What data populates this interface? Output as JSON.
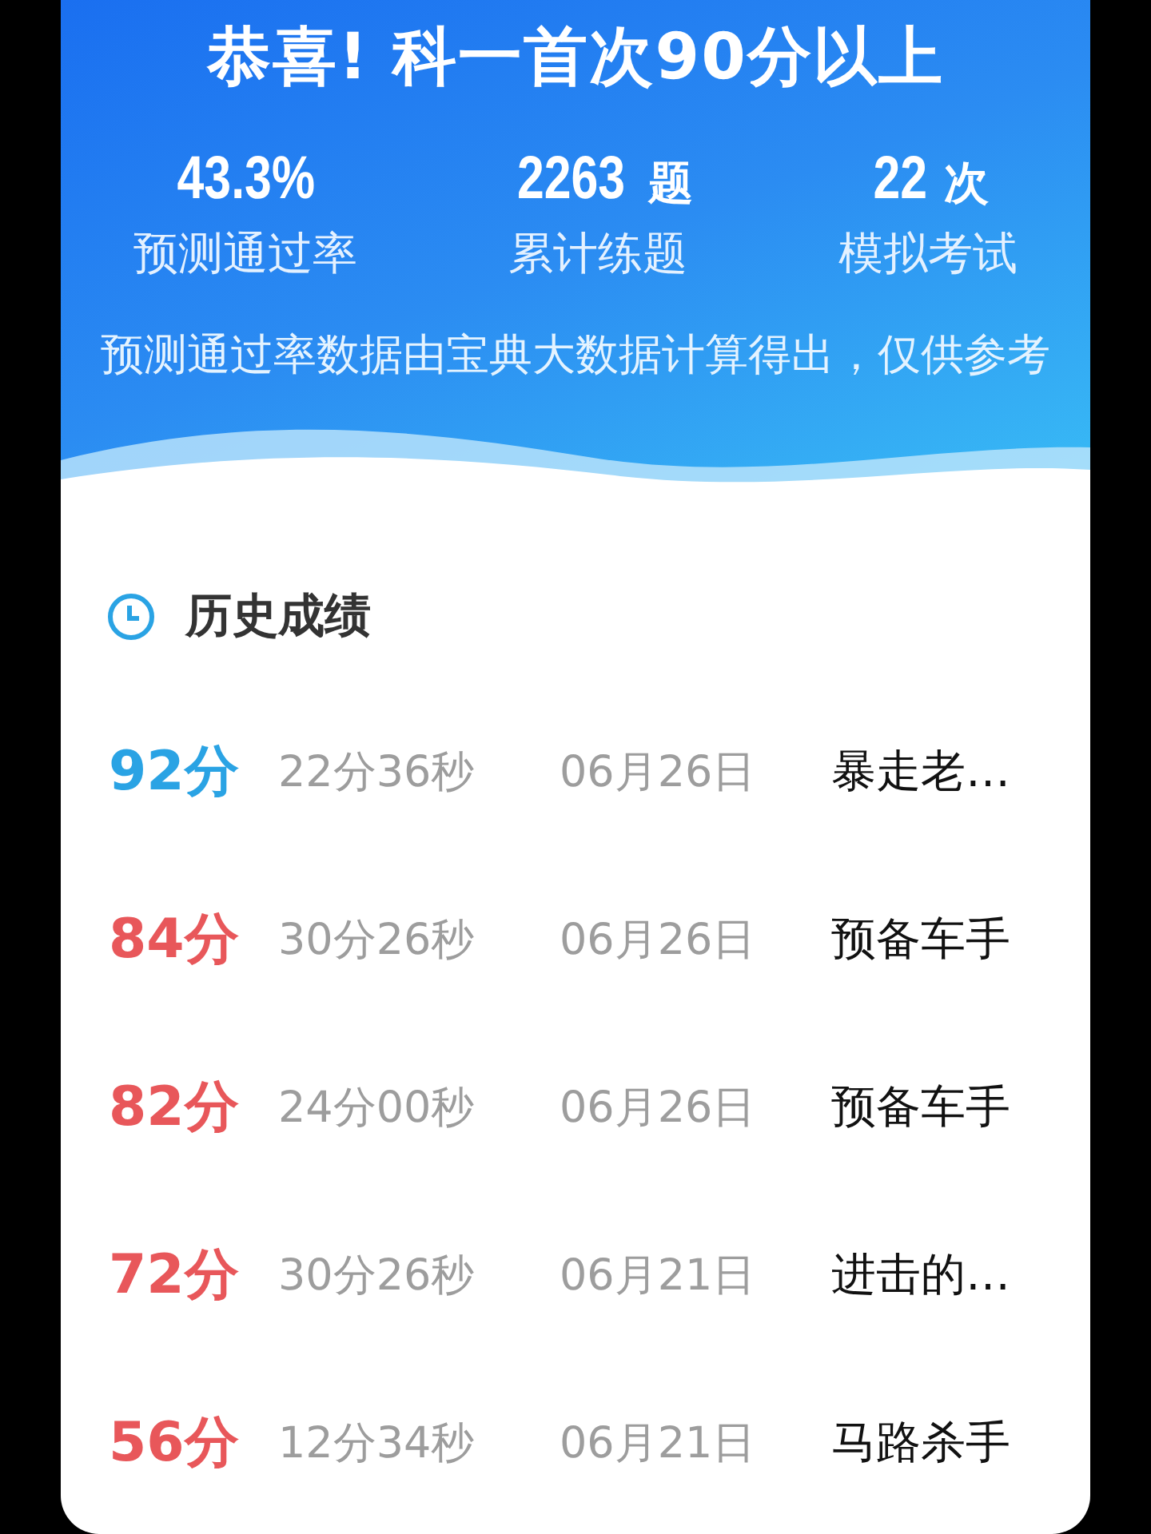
{
  "banner": {
    "title": "恭喜! 科一首次90分以上",
    "stats": [
      {
        "value": "43.3%",
        "label": "预测通过率"
      },
      {
        "value": "2263",
        "unit": "题",
        "label": "累计练题"
      },
      {
        "value": "22",
        "unit": "次",
        "label": "模拟考试"
      }
    ],
    "note": "预测通过率数据由宝典大数据计算得出，仅供参考"
  },
  "history": {
    "title": "历史成绩",
    "rows": [
      {
        "score": "92分",
        "duration": "22分36秒",
        "date": "06月26日",
        "rank": "暴走老…",
        "color": "#2aa3e4"
      },
      {
        "score": "84分",
        "duration": "30分26秒",
        "date": "06月26日",
        "rank": "预备车手",
        "color": "#e8575a"
      },
      {
        "score": "82分",
        "duration": "24分00秒",
        "date": "06月26日",
        "rank": "预备车手",
        "color": "#e8575a"
      },
      {
        "score": "72分",
        "duration": "30分26秒",
        "date": "06月21日",
        "rank": "进击的…",
        "color": "#e8575a"
      },
      {
        "score": "56分",
        "duration": "12分34秒",
        "date": "06月21日",
        "rank": "马路杀手",
        "color": "#e8575a"
      }
    ]
  }
}
